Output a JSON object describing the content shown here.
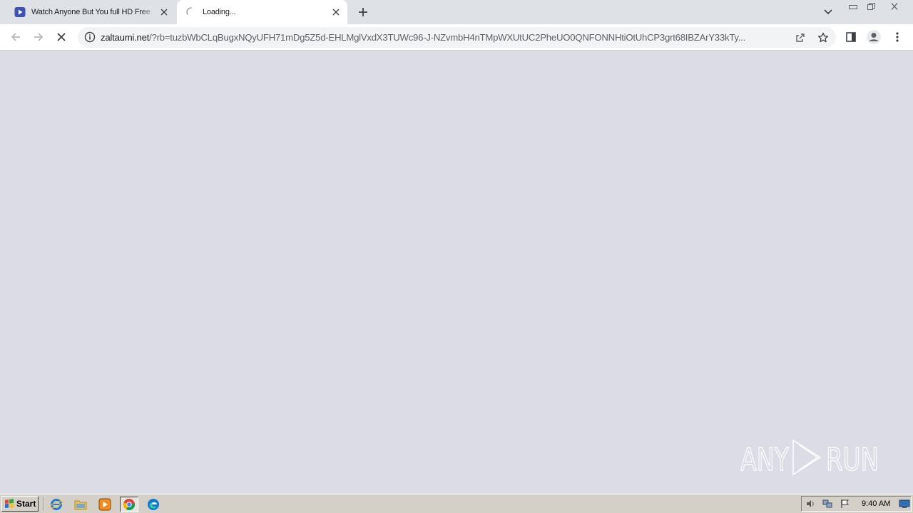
{
  "browser": {
    "tabs": [
      {
        "title": "Watch Anyone But You full HD Free",
        "state": "inactive"
      },
      {
        "title": "Loading...",
        "state": "active-loading"
      }
    ],
    "address": {
      "domain": "zaltaumi.net",
      "path": "/?rb=tuzbWbCLqBugxNQyUFH71mDg5Z5d-EHLMglVxdX3TUWc96-J-NZvmbH4nTMpWXUtUC2PheUO0QNFONNHtiOtUhCP3grt68IBZArY33kTy..."
    }
  },
  "watermark": {
    "text": "ANY RUN"
  },
  "taskbar": {
    "start_label": "Start",
    "clock": "9:40 AM"
  },
  "colors": {
    "tabstrip": "#dee1e6",
    "page_bg": "#dcdce6",
    "taskbar": "#d4d0c8"
  }
}
